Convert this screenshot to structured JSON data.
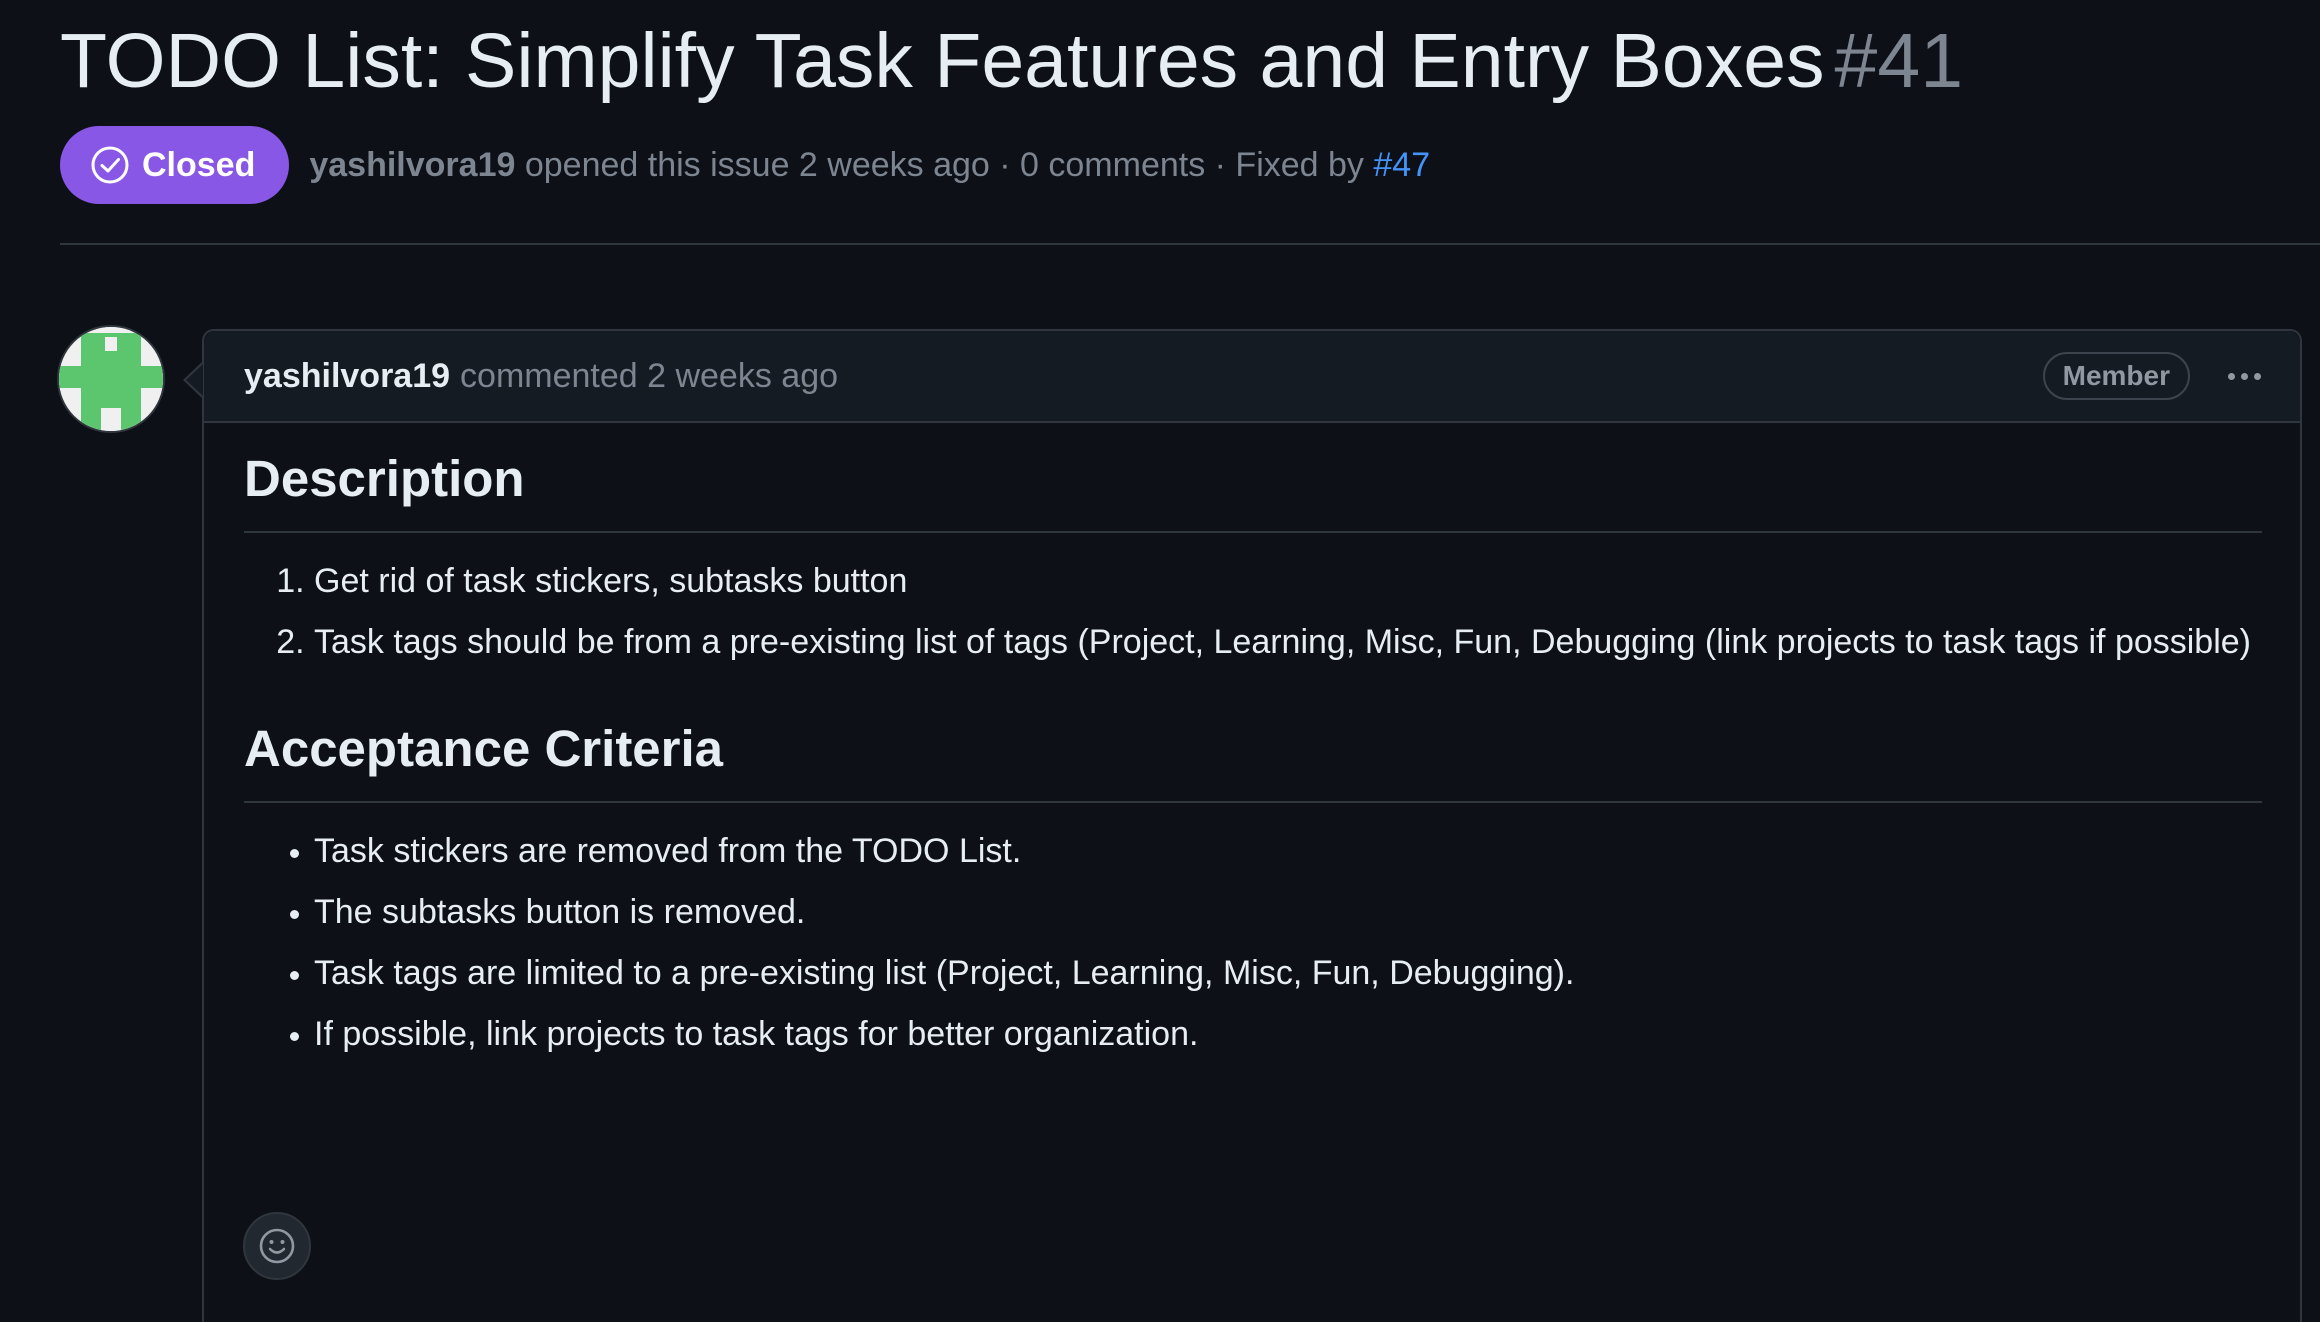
{
  "issue": {
    "title": "TODO List: Simplify Task Features and Entry Boxes",
    "number": "#41"
  },
  "meta": {
    "state_label": "Closed",
    "state_icon": "check-circle-icon",
    "state_color": "#8957e5",
    "author": "yashilvora19",
    "opened_text": "opened this issue 2 weeks ago · 0 comments · Fixed by",
    "fixed_by_link": "#47",
    "link_color": "#4493f8"
  },
  "comment": {
    "author": "yashilvora19",
    "time_text": "commented 2 weeks ago",
    "role_badge": "Member",
    "menu_icon": "kebab-horizontal-icon",
    "description_heading": "Description",
    "description_items": [
      "Get rid of task stickers, subtasks button",
      "Task tags should be from a pre-existing list of tags (Project, Learning, Misc, Fun, Debugging (link projects to task tags if possible)"
    ],
    "acceptance_heading": "Acceptance Criteria",
    "acceptance_items": [
      "Task stickers are removed from the TODO List.",
      "The subtasks button is removed.",
      "Task tags are limited to a pre-existing list (Project, Learning, Misc, Fun, Debugging).",
      "If possible, link projects to task tags for better organization."
    ],
    "reaction_icon": "smiley-icon"
  },
  "colors": {
    "background": "#0d1117",
    "header_background": "#151b23",
    "border": "#30363d",
    "muted_text": "#7d8590",
    "avatar_green": "#5cc66f"
  }
}
